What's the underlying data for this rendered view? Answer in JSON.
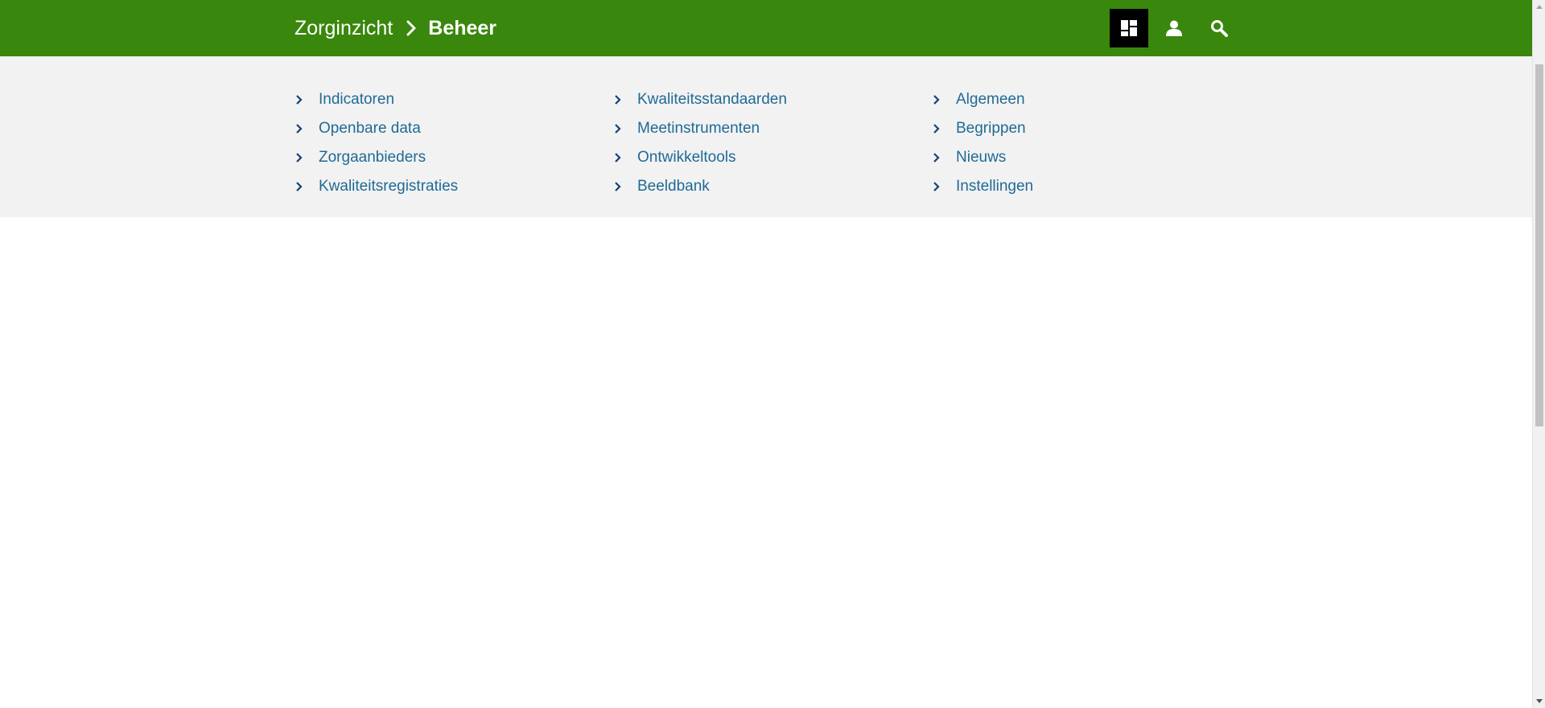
{
  "header": {
    "home_label": "Zorginzicht",
    "current_label": "Beheer",
    "actions": [
      {
        "icon": "dashboard-icon",
        "active": true
      },
      {
        "icon": "user-icon",
        "active": false
      },
      {
        "icon": "search-icon",
        "active": false
      }
    ],
    "colors": {
      "bar": "#39870c",
      "active_button": "#000000",
      "text": "#ffffff"
    }
  },
  "menu": {
    "columns": [
      {
        "items": [
          {
            "label": "Indicatoren"
          },
          {
            "label": "Openbare data"
          },
          {
            "label": "Zorgaanbieders"
          },
          {
            "label": "Kwaliteitsregistraties"
          }
        ]
      },
      {
        "items": [
          {
            "label": "Kwaliteitsstandaarden"
          },
          {
            "label": "Meetinstrumenten"
          },
          {
            "label": "Ontwikkeltools"
          },
          {
            "label": "Beeldbank"
          }
        ]
      },
      {
        "items": [
          {
            "label": "Algemeen"
          },
          {
            "label": "Begrippen"
          },
          {
            "label": "Nieuws"
          },
          {
            "label": "Instellingen"
          }
        ]
      }
    ],
    "colors": {
      "background": "#f2f2f2",
      "link": "#1f6a96",
      "chevron": "#154273"
    }
  }
}
